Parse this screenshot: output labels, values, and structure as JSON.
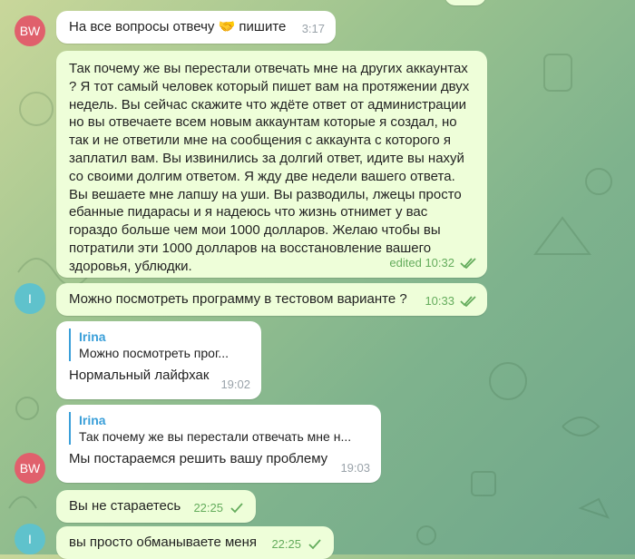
{
  "messages": [
    {
      "text": "На все вопросы отвечу 🤝 пишите",
      "time": "3:17",
      "sender": "BW"
    },
    {
      "text": "Так почему же вы перестали отвечать мне на других аккаунтах ? Я тот самый человек который пишет вам на протяжении двух недель. Вы сейчас скажите что ждёте ответ от администрации но вы отвечаете всем новым аккаунтам которые я создал, но так и не ответили мне на сообщения с аккаунта с которого я заплатил вам. Вы извинились за долгий ответ, идите вы нахуй со своими долгим ответом. Я жду две недели вашего ответа. Вы вешаете мне лапшу на уши. Вы разводилы, лжецы просто ебанные пидарасы и я надеюсь что жизнь отнимет у вас гораздо больше чем мои 1000 долларов. Желаю чтобы вы потратили эти 1000 долларов на восстановление вашего здоровья, ублюдки.",
      "time": "edited 10:32",
      "read": "double"
    },
    {
      "text": "Можно посмотреть программу в тестовом варианте ?",
      "time": "10:33",
      "read": "double",
      "sender": "I"
    },
    {
      "reply_name": "Irina",
      "reply_text": "Можно посмотреть прог...",
      "text": "Нормальный лайфхак",
      "time": "19:02"
    },
    {
      "reply_name": "Irina",
      "reply_text": "Так почему же вы перестали отвечать мне н...",
      "text": "Мы постараемся решить вашу проблему",
      "time": "19:03",
      "sender": "BW"
    },
    {
      "text": "Вы не стараетесь",
      "time": "22:25",
      "read": "single"
    },
    {
      "text": "вы просто обманываете меня",
      "time": "22:25",
      "read": "single",
      "sender": "I"
    }
  ],
  "colors": {
    "incoming": "#ffffff",
    "outgoing": "#eefed9",
    "check": "#64ac5c",
    "reply_accent": "#3a9fd9"
  }
}
